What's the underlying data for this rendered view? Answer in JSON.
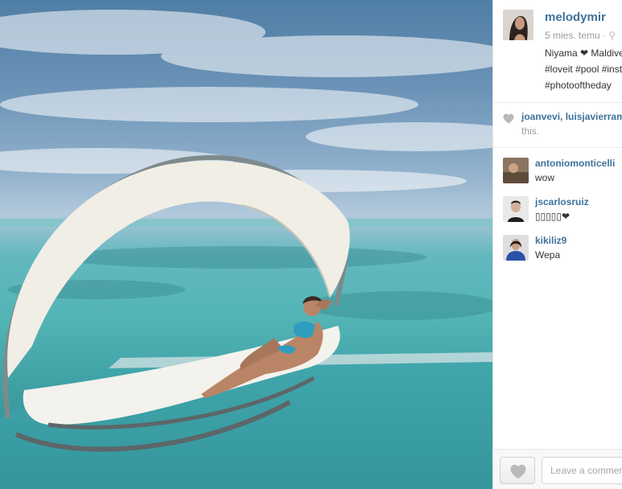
{
  "post": {
    "username": "melodymir",
    "time_ago": "5 mies. temu",
    "meta_separator": "·",
    "caption_lines": [
      "Niyama ❤ Maldives",
      "#loveit #pool #instagood",
      "#photooftheday"
    ]
  },
  "likes": {
    "names": "joanvevi, luisjavierramos",
    "rest": "this."
  },
  "comments": [
    {
      "username": "antoniomonticelli",
      "text": "wow"
    },
    {
      "username": "jscarlosruiz",
      "text": "▯▯▯▯▯❤"
    },
    {
      "username": "kikiliz9",
      "text": "Wepa"
    }
  ],
  "composer": {
    "placeholder": "Leave a comment..."
  },
  "icons": {
    "likes": "heart-icon",
    "like_button": "heart-icon"
  },
  "colors": {
    "link": "#3f729b",
    "muted": "#9a9a9a",
    "heart_grey": "#b9b9b9"
  }
}
